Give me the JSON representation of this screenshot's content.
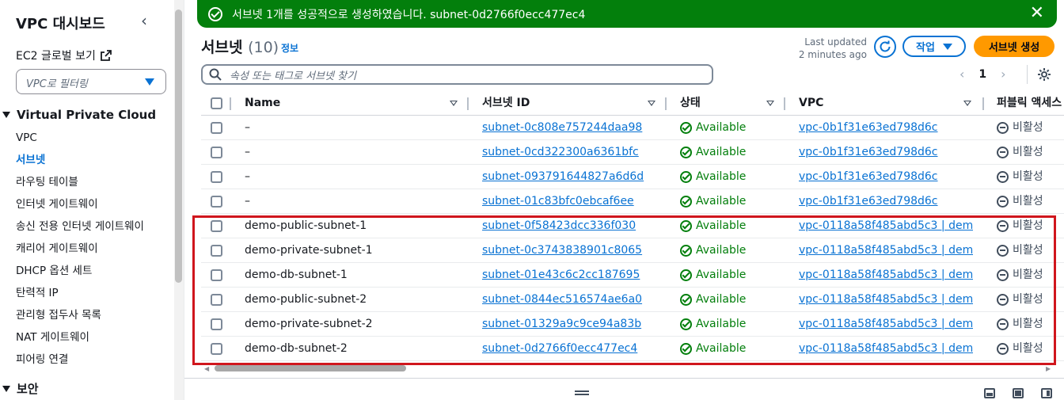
{
  "sidebar": {
    "title": "VPC 대시보드",
    "ec2_global_view": "EC2 글로벌 보기",
    "filter_placeholder": "VPC로 필터링",
    "section_vpc": "Virtual Private Cloud",
    "items": [
      {
        "label": "VPC"
      },
      {
        "label": "서브넷"
      },
      {
        "label": "라우팅 테이블"
      },
      {
        "label": "인터넷 게이트웨이"
      },
      {
        "label": "송신 전용 인터넷 게이트웨이"
      },
      {
        "label": "캐리어 게이트웨이"
      },
      {
        "label": "DHCP 옵션 세트"
      },
      {
        "label": "탄력적 IP"
      },
      {
        "label": "관리형 접두사 목록"
      },
      {
        "label": "NAT 게이트웨이"
      },
      {
        "label": "피어링 연결"
      }
    ],
    "active_item": "서브넷",
    "section_security": "보안"
  },
  "flash": {
    "message": "서브넷 1개를 성공적으로 생성하였습니다. subnet-0d2766f0ecc477ec4"
  },
  "header": {
    "title": "서브넷",
    "count": "(10)",
    "info": "정보",
    "last_updated_label": "Last updated",
    "last_updated_value": "2 minutes ago",
    "action_button": "작업",
    "create_button": "서브넷 생성"
  },
  "search": {
    "placeholder": "속성 또는 태그로 서브넷 찾기"
  },
  "pagination": {
    "current_page": "1"
  },
  "table": {
    "columns": [
      "Name",
      "서브넷 ID",
      "상태",
      "VPC",
      "퍼블릭 액세스"
    ],
    "rows": [
      {
        "name": "–",
        "subnet_id": "subnet-0c808e757244daa98",
        "status": "Available",
        "vpc": "vpc-0b1f31e63ed798d6c",
        "public": "비활성"
      },
      {
        "name": "–",
        "subnet_id": "subnet-0cd322300a6361bfc",
        "status": "Available",
        "vpc": "vpc-0b1f31e63ed798d6c",
        "public": "비활성"
      },
      {
        "name": "–",
        "subnet_id": "subnet-093791644827a6d6d",
        "status": "Available",
        "vpc": "vpc-0b1f31e63ed798d6c",
        "public": "비활성"
      },
      {
        "name": "–",
        "subnet_id": "subnet-01c83bfc0ebcaf6ee",
        "status": "Available",
        "vpc": "vpc-0b1f31e63ed798d6c",
        "public": "비활성"
      },
      {
        "name": "demo-public-subnet-1",
        "subnet_id": "subnet-0f58423dcc336f030",
        "status": "Available",
        "vpc": "vpc-0118a58f485abd5c3 | dem...",
        "public": "비활성"
      },
      {
        "name": "demo-private-subnet-1",
        "subnet_id": "subnet-0c3743838901c8065",
        "status": "Available",
        "vpc": "vpc-0118a58f485abd5c3 | dem...",
        "public": "비활성"
      },
      {
        "name": "demo-db-subnet-1",
        "subnet_id": "subnet-01e43c6c2cc187695",
        "status": "Available",
        "vpc": "vpc-0118a58f485abd5c3 | dem...",
        "public": "비활성"
      },
      {
        "name": "demo-public-subnet-2",
        "subnet_id": "subnet-0844ec516574ae6a0",
        "status": "Available",
        "vpc": "vpc-0118a58f485abd5c3 | dem...",
        "public": "비활성"
      },
      {
        "name": "demo-private-subnet-2",
        "subnet_id": "subnet-01329a9c9ce94a83b",
        "status": "Available",
        "vpc": "vpc-0118a58f485abd5c3 | dem...",
        "public": "비활성"
      },
      {
        "name": "demo-db-subnet-2",
        "subnet_id": "subnet-0d2766f0ecc477ec4",
        "status": "Available",
        "vpc": "vpc-0118a58f485abd5c3 | dem...",
        "public": "비활성"
      }
    ]
  },
  "colors": {
    "success": "#037f0c",
    "link": "#0972d3",
    "primary_button": "#ff9900",
    "highlight": "#d0161d"
  }
}
